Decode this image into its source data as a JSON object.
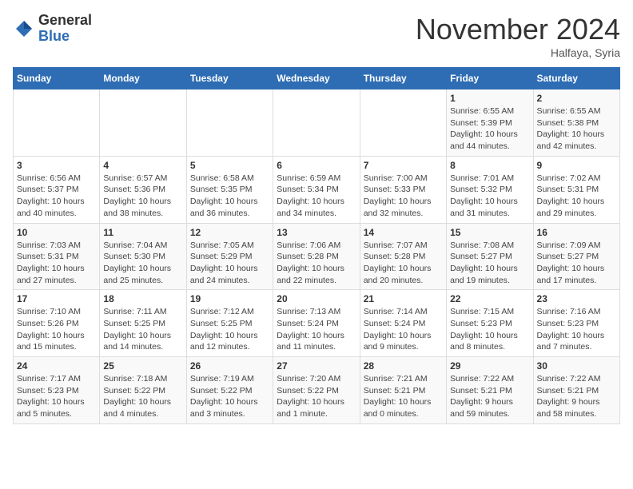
{
  "header": {
    "logo_line1": "General",
    "logo_line2": "Blue",
    "month": "November 2024",
    "location": "Halfaya, Syria"
  },
  "weekdays": [
    "Sunday",
    "Monday",
    "Tuesday",
    "Wednesday",
    "Thursday",
    "Friday",
    "Saturday"
  ],
  "weeks": [
    [
      {
        "day": "",
        "info": ""
      },
      {
        "day": "",
        "info": ""
      },
      {
        "day": "",
        "info": ""
      },
      {
        "day": "",
        "info": ""
      },
      {
        "day": "",
        "info": ""
      },
      {
        "day": "1",
        "info": "Sunrise: 6:55 AM\nSunset: 5:39 PM\nDaylight: 10 hours\nand 44 minutes."
      },
      {
        "day": "2",
        "info": "Sunrise: 6:55 AM\nSunset: 5:38 PM\nDaylight: 10 hours\nand 42 minutes."
      }
    ],
    [
      {
        "day": "3",
        "info": "Sunrise: 6:56 AM\nSunset: 5:37 PM\nDaylight: 10 hours\nand 40 minutes."
      },
      {
        "day": "4",
        "info": "Sunrise: 6:57 AM\nSunset: 5:36 PM\nDaylight: 10 hours\nand 38 minutes."
      },
      {
        "day": "5",
        "info": "Sunrise: 6:58 AM\nSunset: 5:35 PM\nDaylight: 10 hours\nand 36 minutes."
      },
      {
        "day": "6",
        "info": "Sunrise: 6:59 AM\nSunset: 5:34 PM\nDaylight: 10 hours\nand 34 minutes."
      },
      {
        "day": "7",
        "info": "Sunrise: 7:00 AM\nSunset: 5:33 PM\nDaylight: 10 hours\nand 32 minutes."
      },
      {
        "day": "8",
        "info": "Sunrise: 7:01 AM\nSunset: 5:32 PM\nDaylight: 10 hours\nand 31 minutes."
      },
      {
        "day": "9",
        "info": "Sunrise: 7:02 AM\nSunset: 5:31 PM\nDaylight: 10 hours\nand 29 minutes."
      }
    ],
    [
      {
        "day": "10",
        "info": "Sunrise: 7:03 AM\nSunset: 5:31 PM\nDaylight: 10 hours\nand 27 minutes."
      },
      {
        "day": "11",
        "info": "Sunrise: 7:04 AM\nSunset: 5:30 PM\nDaylight: 10 hours\nand 25 minutes."
      },
      {
        "day": "12",
        "info": "Sunrise: 7:05 AM\nSunset: 5:29 PM\nDaylight: 10 hours\nand 24 minutes."
      },
      {
        "day": "13",
        "info": "Sunrise: 7:06 AM\nSunset: 5:28 PM\nDaylight: 10 hours\nand 22 minutes."
      },
      {
        "day": "14",
        "info": "Sunrise: 7:07 AM\nSunset: 5:28 PM\nDaylight: 10 hours\nand 20 minutes."
      },
      {
        "day": "15",
        "info": "Sunrise: 7:08 AM\nSunset: 5:27 PM\nDaylight: 10 hours\nand 19 minutes."
      },
      {
        "day": "16",
        "info": "Sunrise: 7:09 AM\nSunset: 5:27 PM\nDaylight: 10 hours\nand 17 minutes."
      }
    ],
    [
      {
        "day": "17",
        "info": "Sunrise: 7:10 AM\nSunset: 5:26 PM\nDaylight: 10 hours\nand 15 minutes."
      },
      {
        "day": "18",
        "info": "Sunrise: 7:11 AM\nSunset: 5:25 PM\nDaylight: 10 hours\nand 14 minutes."
      },
      {
        "day": "19",
        "info": "Sunrise: 7:12 AM\nSunset: 5:25 PM\nDaylight: 10 hours\nand 12 minutes."
      },
      {
        "day": "20",
        "info": "Sunrise: 7:13 AM\nSunset: 5:24 PM\nDaylight: 10 hours\nand 11 minutes."
      },
      {
        "day": "21",
        "info": "Sunrise: 7:14 AM\nSunset: 5:24 PM\nDaylight: 10 hours\nand 9 minutes."
      },
      {
        "day": "22",
        "info": "Sunrise: 7:15 AM\nSunset: 5:23 PM\nDaylight: 10 hours\nand 8 minutes."
      },
      {
        "day": "23",
        "info": "Sunrise: 7:16 AM\nSunset: 5:23 PM\nDaylight: 10 hours\nand 7 minutes."
      }
    ],
    [
      {
        "day": "24",
        "info": "Sunrise: 7:17 AM\nSunset: 5:23 PM\nDaylight: 10 hours\nand 5 minutes."
      },
      {
        "day": "25",
        "info": "Sunrise: 7:18 AM\nSunset: 5:22 PM\nDaylight: 10 hours\nand 4 minutes."
      },
      {
        "day": "26",
        "info": "Sunrise: 7:19 AM\nSunset: 5:22 PM\nDaylight: 10 hours\nand 3 minutes."
      },
      {
        "day": "27",
        "info": "Sunrise: 7:20 AM\nSunset: 5:22 PM\nDaylight: 10 hours\nand 1 minute."
      },
      {
        "day": "28",
        "info": "Sunrise: 7:21 AM\nSunset: 5:21 PM\nDaylight: 10 hours\nand 0 minutes."
      },
      {
        "day": "29",
        "info": "Sunrise: 7:22 AM\nSunset: 5:21 PM\nDaylight: 9 hours\nand 59 minutes."
      },
      {
        "day": "30",
        "info": "Sunrise: 7:22 AM\nSunset: 5:21 PM\nDaylight: 9 hours\nand 58 minutes."
      }
    ]
  ]
}
